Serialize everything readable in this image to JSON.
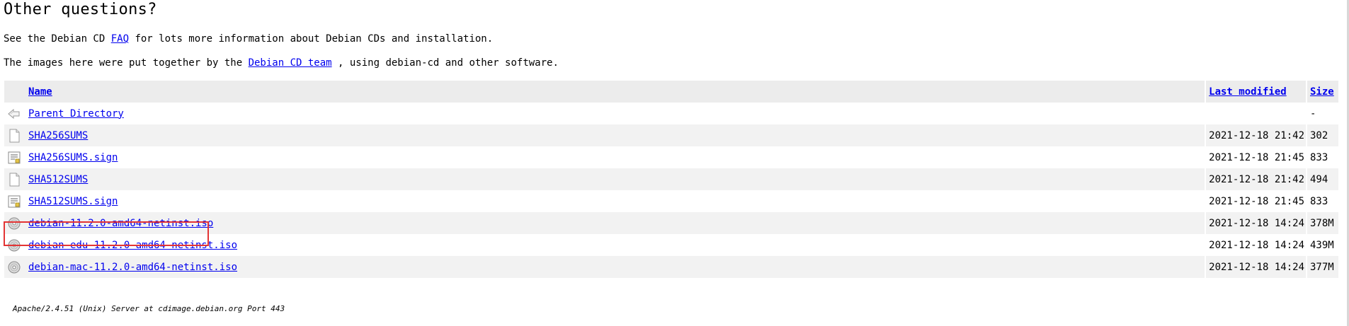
{
  "heading": "Other questions?",
  "para1": {
    "before": "See the Debian CD ",
    "link": "FAQ",
    "after": " for lots more information about Debian CDs and installation."
  },
  "para2": {
    "before": "The images here were put together by the ",
    "link": "Debian CD team",
    "after": " , using debian-cd and other software."
  },
  "table": {
    "headers": {
      "name": "Name",
      "last_modified": "Last modified",
      "size": "Size"
    },
    "rows": [
      {
        "icon": "back-icon",
        "name": "Parent Directory",
        "modified": "",
        "size": "-"
      },
      {
        "icon": "text-file-icon",
        "name": "SHA256SUMS",
        "modified": "2021-12-18 21:42",
        "size": "302"
      },
      {
        "icon": "signed-file-icon",
        "name": "SHA256SUMS.sign",
        "modified": "2021-12-18 21:45",
        "size": "833"
      },
      {
        "icon": "text-file-icon",
        "name": "SHA512SUMS",
        "modified": "2021-12-18 21:42",
        "size": "494"
      },
      {
        "icon": "signed-file-icon",
        "name": "SHA512SUMS.sign",
        "modified": "2021-12-18 21:45",
        "size": "833"
      },
      {
        "icon": "disc-image-icon",
        "name": "debian-11.2.0-amd64-netinst.iso",
        "modified": "2021-12-18 14:24",
        "size": "378M"
      },
      {
        "icon": "disc-image-icon",
        "name": "debian-edu-11.2.0-amd64-netinst.iso",
        "modified": "2021-12-18 14:24",
        "size": "439M"
      },
      {
        "icon": "disc-image-icon",
        "name": "debian-mac-11.2.0-amd64-netinst.iso",
        "modified": "2021-12-18 14:24",
        "size": "377M"
      }
    ]
  },
  "footer": "Apache/2.4.51 (Unix) Server at cdimage.debian.org Port 443",
  "colors": {
    "link": "#0000ee",
    "header_bg": "#ececec",
    "odd_row_bg": "#f2f2f2",
    "highlight_border": "#e33434"
  }
}
